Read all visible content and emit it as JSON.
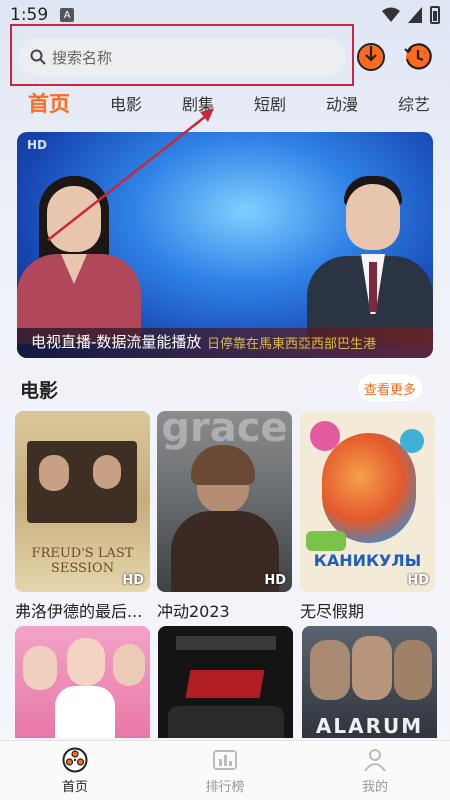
{
  "status_bar": {
    "time": "1:59",
    "sim_label": "A"
  },
  "search": {
    "placeholder": "搜索名称"
  },
  "nav": {
    "tabs": [
      "首页",
      "电影",
      "剧集",
      "短剧",
      "动漫",
      "综艺"
    ],
    "active": "首页"
  },
  "banner": {
    "caption": "电视直播-数据流量能播放",
    "logo": "HD",
    "ticker_text": "日停靠在馬東西亞西部巴生港"
  },
  "movies": {
    "section_title": "电影",
    "more_label": "查看更多",
    "badge": "HD",
    "items": [
      {
        "title": "弗洛伊德的最后...",
        "poster_text": "FREUD'S LAST SESSION"
      },
      {
        "title": "冲动2023",
        "poster_text": "grace"
      },
      {
        "title": "无尽假期",
        "poster_text": "КАНИКУЛЫ"
      }
    ],
    "row2_poster_text": [
      "",
      "",
      "ALARUM"
    ]
  },
  "bottom_nav": {
    "items": [
      "首页",
      "排行榜",
      "我的"
    ],
    "active": "首页"
  },
  "colors": {
    "accent": "#ff6a1e",
    "annotation": "#c8283a"
  }
}
